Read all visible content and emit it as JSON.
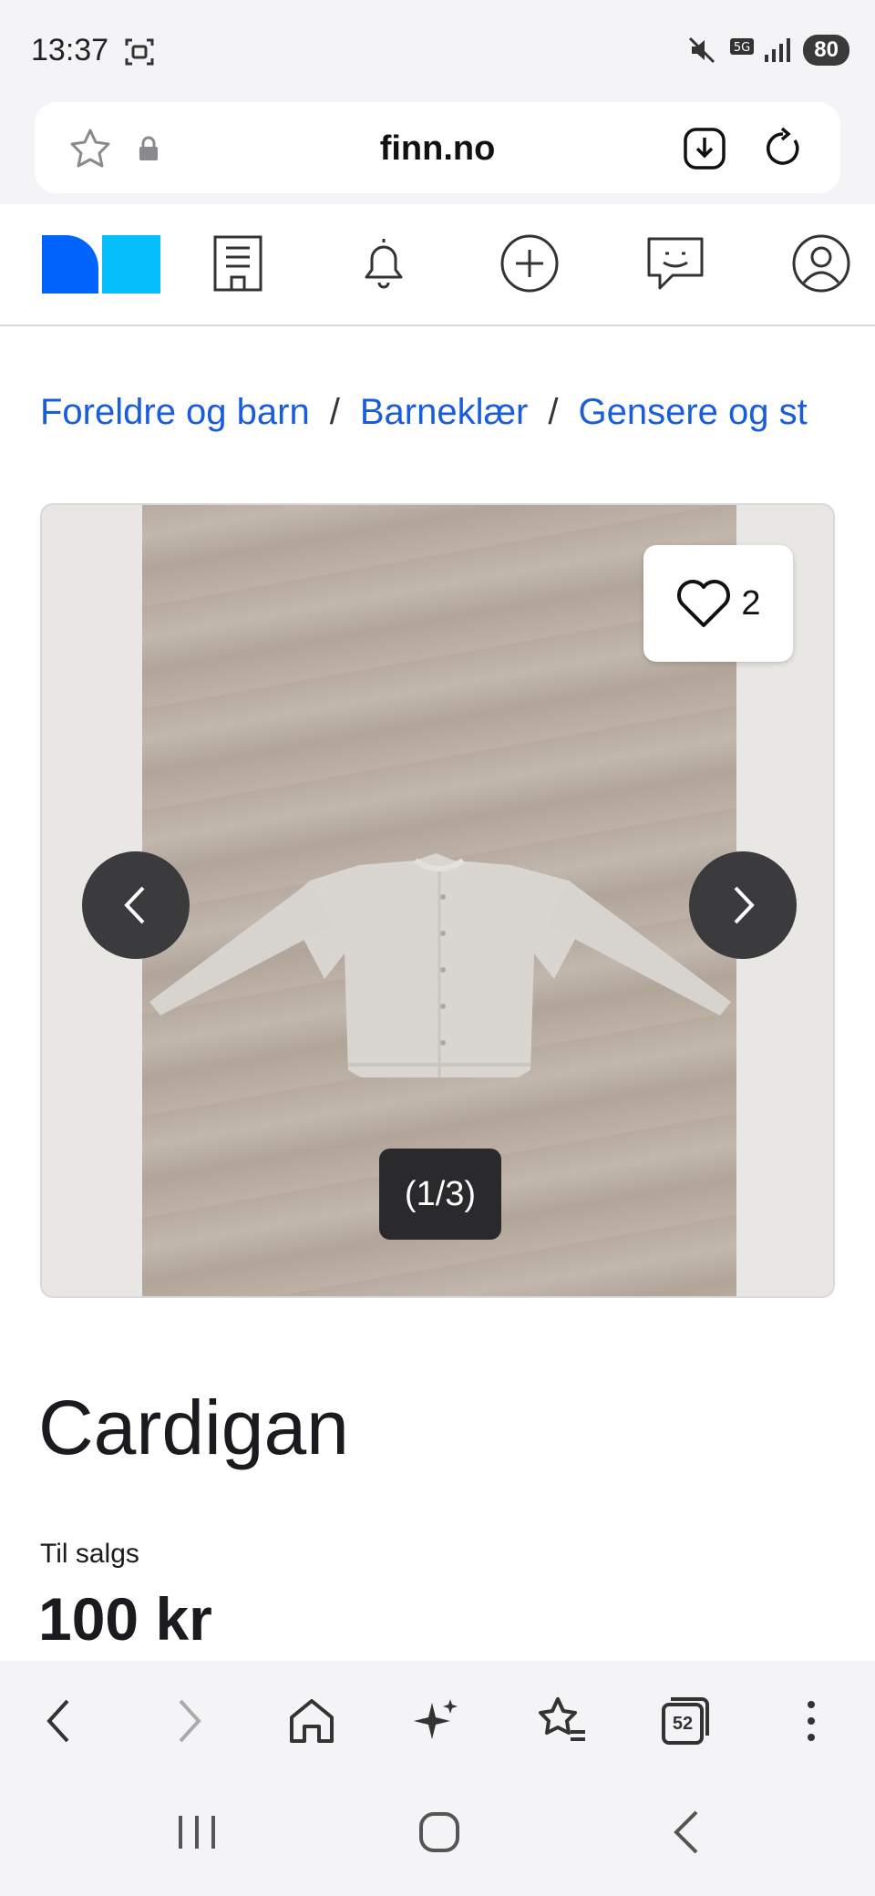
{
  "status_bar": {
    "time": "13:37",
    "battery": "80"
  },
  "browser": {
    "url": "finn.no",
    "tabs_count": "52"
  },
  "breadcrumb": [
    "Foreldre og barn",
    "Barneklær",
    "Gensere og st"
  ],
  "gallery": {
    "favorites_count": "2",
    "image_counter": "(1/3)"
  },
  "listing": {
    "title": "Cardigan",
    "status_label": "Til salgs",
    "price": "100 kr"
  },
  "colors": {
    "accent_blue": "#1a5ddb",
    "logo_blue_dark": "#0063fb",
    "logo_blue_light": "#06befb"
  }
}
